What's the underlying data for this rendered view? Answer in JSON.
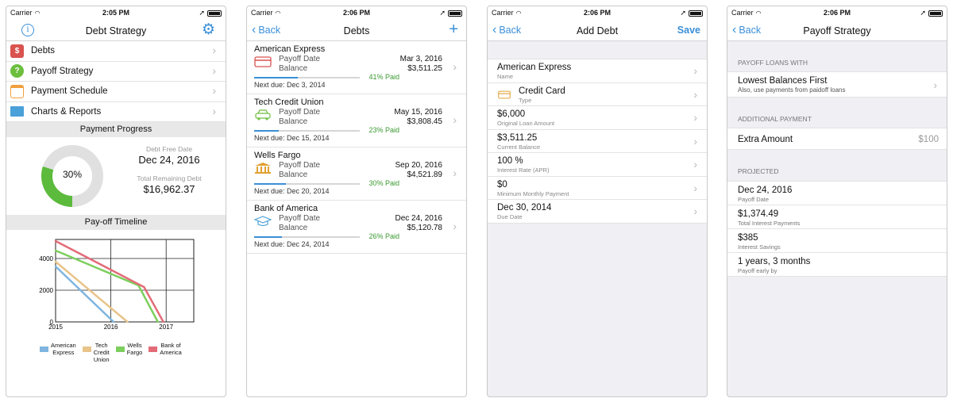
{
  "status": {
    "carrier": "Carrier",
    "times": [
      "2:05 PM",
      "2:06 PM",
      "2:06 PM",
      "2:06 PM"
    ]
  },
  "screen1": {
    "title": "Debt Strategy",
    "menu": [
      {
        "label": "Debts",
        "icon": "dollar-icon",
        "color": "#d9534f",
        "glyph": "$"
      },
      {
        "label": "Payoff Strategy",
        "icon": "question-icon",
        "color": "#6cbf3e",
        "glyph": "?"
      },
      {
        "label": "Payment Schedule",
        "icon": "calendar-icon",
        "color": "#f0a040",
        "glyph": ""
      },
      {
        "label": "Charts & Reports",
        "icon": "chart-icon",
        "color": "#4aa0d8",
        "glyph": ""
      }
    ],
    "progress_header": "Payment Progress",
    "progress_percent": 30,
    "progress_label": "30%",
    "debt_free_label": "Debt Free Date",
    "debt_free_date": "Dec 24, 2016",
    "remaining_label": "Total Remaining Debt",
    "remaining_value": "$16,962.37",
    "timeline_header": "Pay-off Timeline",
    "legend": [
      {
        "label": "American\nExpress",
        "color": "#7fb5e0"
      },
      {
        "label": "Tech\nCredit\nUnion",
        "color": "#e8c48a"
      },
      {
        "label": "Wells\nFargo",
        "color": "#7ccf5c"
      },
      {
        "label": "Bank of\nAmerica",
        "color": "#e36b78"
      }
    ]
  },
  "chart_data": {
    "type": "line",
    "title": "Pay-off Timeline",
    "xlabel": "",
    "ylabel": "",
    "xticks": [
      "2015",
      "2016",
      "2017"
    ],
    "yticks": [
      "0",
      "2000",
      "4000"
    ],
    "xlim": [
      2015,
      2017.5
    ],
    "ylim": [
      0,
      5200
    ],
    "series": [
      {
        "name": "American Express",
        "color": "#7fb5e0",
        "x": [
          2015,
          2016.05
        ],
        "y": [
          3500,
          0
        ]
      },
      {
        "name": "Tech Credit Union",
        "color": "#e8c48a",
        "x": [
          2015,
          2016.3
        ],
        "y": [
          3800,
          0
        ]
      },
      {
        "name": "Wells Fargo",
        "color": "#7ccf5c",
        "x": [
          2015,
          2016.5,
          2016.85
        ],
        "y": [
          4500,
          2300,
          0
        ]
      },
      {
        "name": "Bank of America",
        "color": "#e36b78",
        "x": [
          2015,
          2016.6,
          2016.95
        ],
        "y": [
          5100,
          2200,
          0
        ]
      }
    ]
  },
  "screen2": {
    "back": "Back",
    "title": "Debts",
    "add": "+",
    "debts": [
      {
        "name": "American Express",
        "icon": "credit-card-icon",
        "date": "Mar 3, 2016",
        "balance": "$3,511.25",
        "paid": "41% Paid",
        "pct": 0.41,
        "next": "Next due: Dec 3, 2014"
      },
      {
        "name": "Tech Credit Union",
        "icon": "car-icon",
        "date": "May 15, 2016",
        "balance": "$3,808.45",
        "paid": "23% Paid",
        "pct": 0.23,
        "next": "Next due: Dec 15, 2014"
      },
      {
        "name": "Wells Fargo",
        "icon": "bank-icon",
        "date": "Sep 20, 2016",
        "balance": "$4,521.89",
        "paid": "30% Paid",
        "pct": 0.3,
        "next": "Next due: Dec 20, 2014"
      },
      {
        "name": "Bank of America",
        "icon": "graduation-cap-icon",
        "date": "Dec 24, 2016",
        "balance": "$5,120.78",
        "paid": "26% Paid",
        "pct": 0.26,
        "next": "Next due: Dec 24, 2014"
      }
    ],
    "payoff_label": "Payoff Date",
    "balance_label": "Balance"
  },
  "screen3": {
    "back": "Back",
    "title": "Add Debt",
    "save": "Save",
    "fields": [
      {
        "value": "American Express",
        "label": "Name"
      },
      {
        "value": "Credit Card",
        "label": "Type"
      },
      {
        "value": "$6,000",
        "label": "Original Loan Amount"
      },
      {
        "value": "$3,511.25",
        "label": "Current Balance"
      },
      {
        "value": "100 %",
        "label": "Interest Rate (APR)"
      },
      {
        "value": "$0",
        "label": "Minimum Monthly Payment"
      },
      {
        "value": "Dec 30, 2014",
        "label": "Due Date"
      }
    ]
  },
  "screen4": {
    "back": "Back",
    "title": "Payoff Strategy",
    "hdr1": "PAYOFF LOANS WITH",
    "strategy": "Lowest Balances First",
    "strategy_sub": "Also, use payments from paidoff loans",
    "hdr2": "ADDITIONAL PAYMENT",
    "extra_label": "Extra Amount",
    "extra_value": "$100",
    "hdr3": "PROJECTED",
    "projected": [
      {
        "value": "Dec 24, 2016",
        "label": "Payoff Date"
      },
      {
        "value": "$1,374.49",
        "label": "Total Interest Payments"
      },
      {
        "value": "$385",
        "label": "Interest Savings"
      },
      {
        "value": "1 years, 3 months",
        "label": "Payoff early by"
      }
    ]
  }
}
